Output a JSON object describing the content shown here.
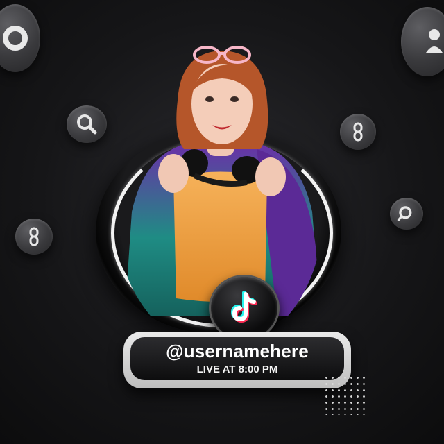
{
  "profile": {
    "handle": "@usernamehere",
    "live_text": "LIVE AT 8:00 PM"
  },
  "icons": {
    "center": "tiktok-logo-icon",
    "floating": [
      "search-icon",
      "link-icon",
      "user-icon"
    ]
  },
  "colors": {
    "background": "#161618",
    "ring_accent": "#f2f2f2",
    "tiktok_cyan": "#25f4ee",
    "tiktok_pink": "#fe2c55",
    "jacket_purple": "#6b2fa8",
    "jacket_teal": "#1f8c84",
    "top_orange": "#f2a244"
  }
}
